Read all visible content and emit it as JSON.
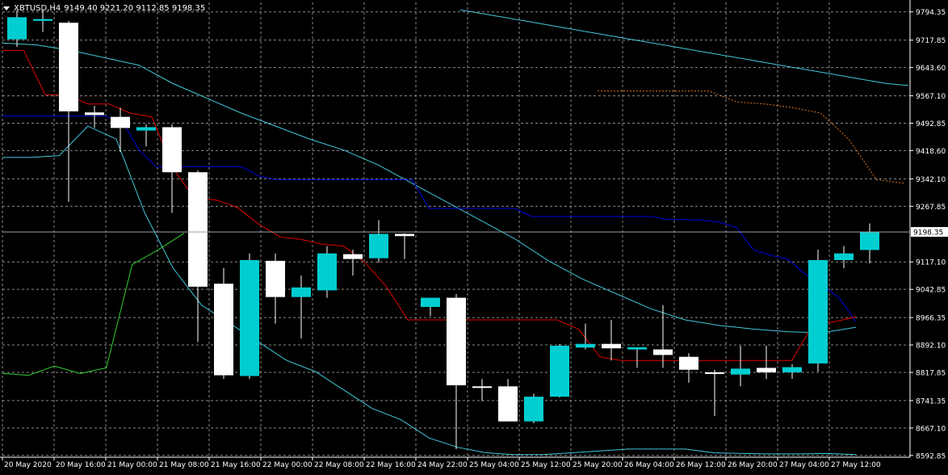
{
  "header": {
    "symbol": "XBTUSD,H4",
    "ohlc": "9149.40 9221.20 9112.85 9198.35"
  },
  "price_label": "9198.35",
  "colors": {
    "background": "#000000",
    "grid": "#8a8a8a",
    "bull": "#00CED1",
    "bear": "#FFFFFF",
    "red_line": "#E00000",
    "blue_line": "#0000E0",
    "cyan_line": "#40C8D8",
    "green_line": "#32CD32",
    "orange_dots": "#E07820",
    "price_line": "#9AA0A8"
  },
  "chart_data": {
    "type": "candlestick",
    "timeframe": "H4",
    "x_tick_labels": [
      "20 May 2020",
      "20 May 16:00",
      "21 May 00:00",
      "21 May 08:00",
      "21 May 16:00",
      "22 May 00:00",
      "22 May 08:00",
      "22 May 16:00",
      "24 May 22:00",
      "25 May 04:00",
      "25 May 12:00",
      "25 May 20:00",
      "26 May 04:00",
      "26 May 12:00",
      "26 May 20:00",
      "27 May 04:00",
      "27 May 12:00"
    ],
    "y_tick_labels": [
      "9794.35",
      "9717.85",
      "9643.60",
      "9567.10",
      "9492.85",
      "9418.60",
      "9342.10",
      "9267.85",
      "9198.35",
      "9117.10",
      "9042.85",
      "8966.35",
      "8892.10",
      "8817.85",
      "8741.35",
      "8667.10",
      "8592.85"
    ],
    "ylim": [
      8588,
      9820
    ],
    "candles": [
      {
        "o": 9720,
        "h": 9800,
        "l": 9700,
        "c": 9780
      },
      {
        "o": 9770,
        "h": 9800,
        "l": 9740,
        "c": 9775
      },
      {
        "o": 9765,
        "h": 9770,
        "l": 9280,
        "c": 9525
      },
      {
        "o": 9522,
        "h": 9540,
        "l": 9480,
        "c": 9515
      },
      {
        "o": 9510,
        "h": 9535,
        "l": 9415,
        "c": 9480
      },
      {
        "o": 9473,
        "h": 9490,
        "l": 9430,
        "c": 9482
      },
      {
        "o": 9482,
        "h": 9490,
        "l": 9250,
        "c": 9360
      },
      {
        "o": 9360,
        "h": 9365,
        "l": 8900,
        "c": 9050
      },
      {
        "o": 9058,
        "h": 9100,
        "l": 8800,
        "c": 8810
      },
      {
        "o": 8808,
        "h": 9140,
        "l": 8800,
        "c": 9122
      },
      {
        "o": 9120,
        "h": 9140,
        "l": 8950,
        "c": 9022
      },
      {
        "o": 9022,
        "h": 9080,
        "l": 8910,
        "c": 9048
      },
      {
        "o": 9040,
        "h": 9160,
        "l": 9020,
        "c": 9140
      },
      {
        "o": 9138,
        "h": 9150,
        "l": 9080,
        "c": 9125
      },
      {
        "o": 9127,
        "h": 9230,
        "l": 9115,
        "c": 9193
      },
      {
        "o": 9193,
        "h": 9195,
        "l": 9125,
        "c": 9187
      },
      {
        "o": 8995,
        "h": 9020,
        "l": 8970,
        "c": 9020
      },
      {
        "o": 9020,
        "h": 9030,
        "l": 8610,
        "c": 8783
      },
      {
        "o": 8780,
        "h": 8800,
        "l": 8740,
        "c": 8778
      },
      {
        "o": 8780,
        "h": 8800,
        "l": 8685,
        "c": 8685
      },
      {
        "o": 8685,
        "h": 8760,
        "l": 8680,
        "c": 8752
      },
      {
        "o": 8752,
        "h": 8895,
        "l": 8750,
        "c": 8890
      },
      {
        "o": 8885,
        "h": 8950,
        "l": 8880,
        "c": 8895
      },
      {
        "o": 8895,
        "h": 8960,
        "l": 8850,
        "c": 8883
      },
      {
        "o": 8880,
        "h": 8885,
        "l": 8830,
        "c": 8886
      },
      {
        "o": 8880,
        "h": 9000,
        "l": 8830,
        "c": 8865
      },
      {
        "o": 8860,
        "h": 8870,
        "l": 8790,
        "c": 8825
      },
      {
        "o": 8818,
        "h": 8825,
        "l": 8700,
        "c": 8815
      },
      {
        "o": 8812,
        "h": 8890,
        "l": 8780,
        "c": 8828
      },
      {
        "o": 8830,
        "h": 8890,
        "l": 8800,
        "c": 8818
      },
      {
        "o": 8818,
        "h": 8840,
        "l": 8800,
        "c": 8832
      },
      {
        "o": 8842,
        "h": 9150,
        "l": 8820,
        "c": 9122
      },
      {
        "o": 9122,
        "h": 9160,
        "l": 9100,
        "c": 9140
      },
      {
        "o": 9149.4,
        "h": 9221.2,
        "l": 9112.85,
        "c": 9198.35
      }
    ],
    "current_price": 9198.35,
    "grid": true,
    "indicators": {
      "red_line": [
        9690,
        9690,
        9570,
        9570,
        9545,
        9545,
        9520,
        9510,
        9370,
        9290,
        9285,
        9265,
        9220,
        9185,
        9178,
        9165,
        9160,
        9115,
        9050,
        8960,
        8960,
        8960,
        8960,
        8960,
        8960,
        8960,
        8960,
        8935,
        8860,
        8850,
        8850,
        8850,
        8850,
        8850,
        8850,
        8850,
        8850,
        8850,
        8950,
        8955,
        8968
      ],
      "blue_line": [
        9512,
        9512,
        9512,
        9512,
        9512,
        9512,
        9512,
        9500,
        9420,
        9375,
        9375,
        9375,
        9375,
        9375,
        9375,
        9350,
        9340,
        9340,
        9340,
        9340,
        9340,
        9340,
        9340,
        9340,
        9340,
        9262,
        9262,
        9262,
        9262,
        9262,
        9262,
        9240,
        9240,
        9240,
        9240,
        9240,
        9240,
        9240,
        9240,
        9232,
        9232,
        9230,
        9225,
        9210,
        9150,
        9135,
        9125,
        9085,
        9055,
        9020,
        8955
      ],
      "cyan_upper": [
        9710,
        9705,
        9690,
        9670,
        9650,
        9600,
        9560,
        9520,
        9485,
        9450,
        9420,
        9380,
        9330,
        9280,
        9230,
        9180,
        9120,
        9070,
        9030,
        8990,
        8960,
        8945,
        8935,
        8928,
        8925,
        8940
      ],
      "cyan_middle": [
        9400,
        9400,
        9405,
        9485,
        9450,
        9250,
        9100,
        9000,
        8950,
        8900,
        8850,
        8820,
        8770,
        8720,
        8690,
        8640,
        8615,
        8600,
        8595,
        8595,
        8600,
        8605,
        8610,
        8610,
        8610,
        8600,
        8598,
        8597,
        8597,
        8598,
        8595
      ],
      "cyan_lower": [
        9595,
        9600,
        9610,
        9620,
        9630,
        9640,
        9650,
        9660,
        9670,
        9680,
        9690,
        9700,
        9710,
        9720,
        9730,
        9740,
        9750,
        9760,
        9770,
        9780,
        9790,
        9800
      ],
      "green_line": [
        8815,
        8810,
        8835,
        8815,
        8830,
        9110,
        9150,
        9195
      ],
      "orange_dots": [
        9580,
        9580,
        9580,
        9580,
        9580,
        9550,
        9545,
        9535,
        9520,
        9450,
        9340,
        9330
      ]
    }
  }
}
